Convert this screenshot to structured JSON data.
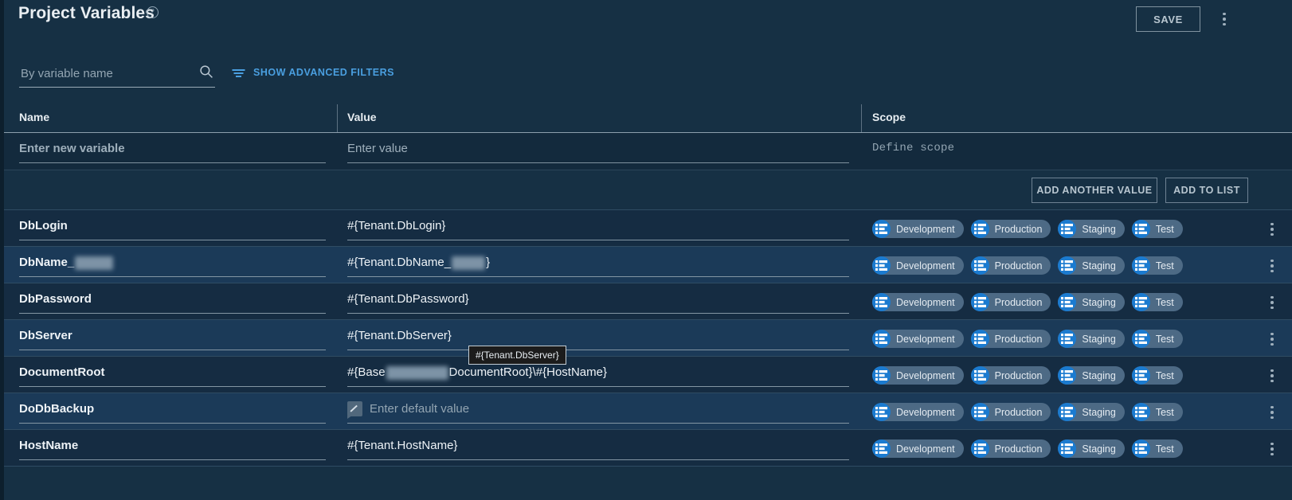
{
  "header": {
    "title": "Project Variables",
    "help_icon": "help-circle-icon",
    "save_label": "SAVE",
    "overflow_icon": "kebab-menu-icon"
  },
  "filters": {
    "search_placeholder": "By variable name",
    "search_value": "",
    "search_icon": "search-icon",
    "advanced_filters_label": "SHOW ADVANCED FILTERS",
    "filter_icon": "filter-lines-icon"
  },
  "table": {
    "columns": [
      "Name",
      "Value",
      "Scope"
    ],
    "new_row": {
      "name_placeholder": "Enter new variable",
      "value_placeholder": "Enter value",
      "scope_placeholder": "Define scope"
    },
    "actions": {
      "add_another_value": "ADD ANOTHER VALUE",
      "add_to_list": "ADD TO LIST"
    },
    "scope_chip_icon": "environment-list-icon",
    "rows": [
      {
        "name": "DbLogin",
        "name_redacted": false,
        "value": "#{Tenant.DbLogin}",
        "value_redacted": false,
        "empty_value": false,
        "scopes": [
          "Development",
          "Production",
          "Staging",
          "Test"
        ]
      },
      {
        "name": "DbName_",
        "name_redacted": true,
        "value_prefix": "#{Tenant.DbName_",
        "value_suffix": "}",
        "value_redacted": true,
        "empty_value": false,
        "scopes": [
          "Development",
          "Production",
          "Staging",
          "Test"
        ]
      },
      {
        "name": "DbPassword",
        "name_redacted": false,
        "value": "#{Tenant.DbPassword}",
        "value_redacted": false,
        "empty_value": false,
        "scopes": [
          "Development",
          "Production",
          "Staging",
          "Test"
        ]
      },
      {
        "name": "DbServer",
        "name_redacted": false,
        "value": "#{Tenant.DbServer}",
        "value_redacted": false,
        "empty_value": false,
        "scopes": [
          "Development",
          "Production",
          "Staging",
          "Test"
        ]
      },
      {
        "name": "DocumentRoot",
        "name_redacted": false,
        "value_prefix": "#{Base",
        "value_suffix": "DocumentRoot}\\#{HostName}",
        "value_redacted": true,
        "empty_value": false,
        "scopes": [
          "Development",
          "Production",
          "Staging",
          "Test"
        ]
      },
      {
        "name": "DoDbBackup",
        "name_redacted": false,
        "value": "",
        "empty_value": true,
        "empty_value_placeholder": "Enter default value",
        "empty_value_icon": "expression-disabled-icon",
        "scopes": [
          "Development",
          "Production",
          "Staging",
          "Test"
        ]
      },
      {
        "name": "HostName",
        "name_redacted": false,
        "value": "#{Tenant.HostName}",
        "value_redacted": false,
        "empty_value": false,
        "scopes": [
          "Development",
          "Production",
          "Staging",
          "Test"
        ]
      }
    ]
  },
  "tooltip": {
    "text": "#{Tenant.DbServer}"
  },
  "colors": {
    "background": "#163044",
    "row_odd": "#152c42",
    "row_even": "#1b3a58",
    "accent_link": "#4a9fe0",
    "chip_icon": "#1b7bd0",
    "chip_background": "#4d6a85"
  }
}
